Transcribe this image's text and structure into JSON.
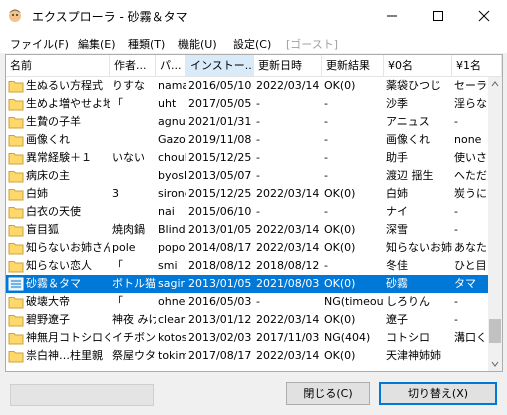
{
  "window": {
    "title": "エクスプローラ - 砂霧＆タマ",
    "controls": [
      "minimize",
      "maximize",
      "close"
    ]
  },
  "menu": [
    {
      "label": "ファイル(F)",
      "enabled": true
    },
    {
      "label": "編集(E)",
      "enabled": true
    },
    {
      "label": "種類(T)",
      "enabled": true
    },
    {
      "label": "機能(U)",
      "enabled": true
    },
    {
      "label": "設定(C)",
      "enabled": true
    },
    {
      "label": "[ゴースト]",
      "enabled": false
    }
  ],
  "columns": [
    "名前",
    "作者...",
    "パ...",
    "インストー...",
    "更新日時",
    "更新結果",
    "¥0名",
    "¥1名"
  ],
  "active_column": 3,
  "rows": [
    [
      "生ぬるい方程式",
      "りすな",
      "nama",
      "2016/05/10",
      "2022/03/14",
      "OK(0)",
      "薬袋ひつじ",
      "セーラ"
    ],
    [
      "生めよ増やせよ地",
      "「",
      "uht",
      "2017/05/05",
      "-",
      "-",
      "沙季",
      "淫らな"
    ],
    [
      "生贄の子羊",
      "",
      "agnus",
      "2021/01/31",
      "-",
      "-",
      "アニュス",
      "-"
    ],
    [
      "画像くれ",
      "",
      "Gazou",
      "2019/11/08",
      "-",
      "-",
      "画像くれ",
      "none"
    ],
    [
      "異常経験＋１",
      "いない",
      "choul",
      "2015/12/25",
      "-",
      "-",
      "助手",
      "使いさ"
    ],
    [
      "病床の主",
      "",
      "byosh",
      "2013/05/07",
      "-",
      "-",
      "渡辺 揺生",
      "へただ"
    ],
    [
      "白姉",
      "3",
      "sirone",
      "2015/12/25",
      "2022/03/14",
      "OK(0)",
      "白姉",
      "炭うに"
    ],
    [
      "白衣の天使",
      "",
      "nai",
      "2015/06/10",
      "-",
      "-",
      "ナイ",
      "-"
    ],
    [
      "盲目狐",
      "焼肉鍋",
      "Blind",
      "2013/01/05",
      "2022/03/14",
      "OK(0)",
      "深雪",
      "-"
    ],
    [
      "知らないお姉さん",
      "pole",
      "popop",
      "2014/08/17",
      "2022/03/14",
      "OK(0)",
      "知らないお姉さ",
      "あなた"
    ],
    [
      "知らない恋人",
      "「",
      "smi",
      "2018/08/12",
      "2018/08/12",
      "-",
      "冬佳",
      "ひと目"
    ],
    [
      "砂霧＆タマ",
      "ボトル猫",
      "sagiri",
      "2013/01/05",
      "2021/08/03",
      "OK(0)",
      "砂霧",
      "タマ"
    ],
    [
      "破壊大帝",
      "「",
      "ohne",
      "2016/05/03",
      "-",
      "NG(timeout)",
      "しろりん",
      "-"
    ],
    [
      "碧野遼子",
      "神夜 みけ",
      "clear",
      "2013/01/12",
      "2022/03/14",
      "OK(0)",
      "遼子",
      "-"
    ],
    [
      "神無月コトシロくんと",
      "イチボン",
      "kotos",
      "2013/02/03",
      "2017/11/03",
      "NG(404)",
      "コトシロ",
      "溝口く"
    ],
    [
      "祟白神…柱里親",
      "祭屋ウタ",
      "tokimo",
      "2017/08/17",
      "2022/03/14",
      "OK(0)",
      "天津神姉姉",
      ""
    ]
  ],
  "selected_row": 11,
  "buttons": {
    "close": "閉じる(C)",
    "switch": "切り替え(X)"
  },
  "colors": {
    "selection": "#0078d7",
    "folder": "#ffd86b",
    "button_focus": "#0078d7"
  }
}
